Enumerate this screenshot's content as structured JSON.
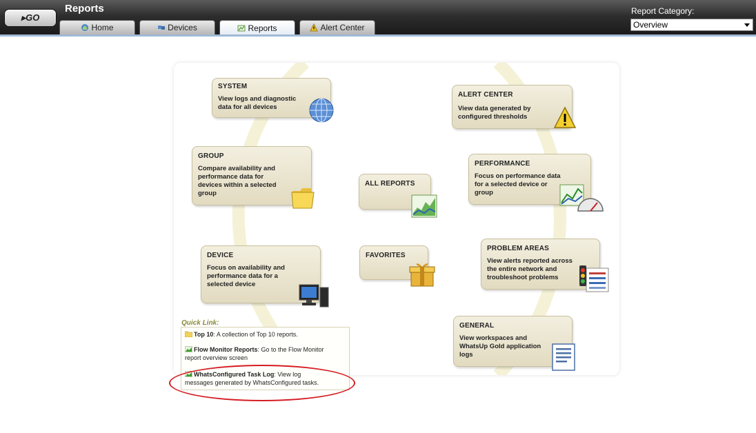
{
  "header": {
    "go_label": "▸GO",
    "app_title": "Reports",
    "report_category_label": "Report Category:",
    "report_category_value": "Overview"
  },
  "tabs": [
    {
      "label": "Home",
      "icon": "home-icon",
      "active": false
    },
    {
      "label": "Devices",
      "icon": "devices-icon",
      "active": false
    },
    {
      "label": "Reports",
      "icon": "reports-icon",
      "active": true
    },
    {
      "label": "Alert Center",
      "icon": "alert-icon",
      "active": false
    }
  ],
  "cards": {
    "system": {
      "title": "SYSTEM",
      "desc1": "View logs and diagnostic",
      "desc2": "data for all devices",
      "icon": "globe-icon"
    },
    "alert_center": {
      "title": "ALERT CENTER",
      "desc1": "View data generated by",
      "desc2": "configured thresholds",
      "icon": "warning-icon"
    },
    "group": {
      "title": "GROUP",
      "desc1": "Compare availability and",
      "desc2": "performance data for",
      "desc3": "devices within a selected",
      "desc4": "group",
      "icon": "folder-icon"
    },
    "all_reports": {
      "title": "ALL REPORTS",
      "icon": "chart-icon"
    },
    "performance": {
      "title": "PERFORMANCE",
      "desc1": "Focus on performance data",
      "desc2": "for a selected device or",
      "desc3": "group",
      "icon": "gauge-icon"
    },
    "device": {
      "title": "DEVICE",
      "desc1": "Focus on availability and",
      "desc2": "performance data for a",
      "desc3": "selected device",
      "icon": "computer-icon"
    },
    "favorites": {
      "title": "FAVORITES",
      "icon": "gift-box-icon"
    },
    "problem_areas": {
      "title": "PROBLEM AREAS",
      "desc1": "View alerts reported across",
      "desc2": "the entire network and",
      "desc3": "troubleshoot problems",
      "icon": "traffic-light-icon"
    },
    "general": {
      "title": "GENERAL",
      "desc1": "View workspaces and",
      "desc2": "WhatsUp Gold application",
      "desc3": "logs",
      "icon": "document-icon"
    }
  },
  "quick_link": {
    "title": "Quick Link:",
    "items": [
      {
        "name": "Top 10",
        "text": ": A collection of Top 10 reports.",
        "icon": "folder-icon"
      },
      {
        "name": "Flow Monitor Reports",
        "text": ": Go to the Flow Monitor",
        "text2": "report overview screen",
        "icon": "report-icon"
      },
      {
        "name": "WhatsConfigured Task Log",
        "text": ": View log",
        "text2": "messages generated by WhatsConfigured tasks.",
        "icon": "report-icon"
      }
    ]
  },
  "colors": {
    "accent_line": "#9fb9d6",
    "highlight_ellipse": "#d51d22",
    "card_bg": "#e8e1c8"
  }
}
